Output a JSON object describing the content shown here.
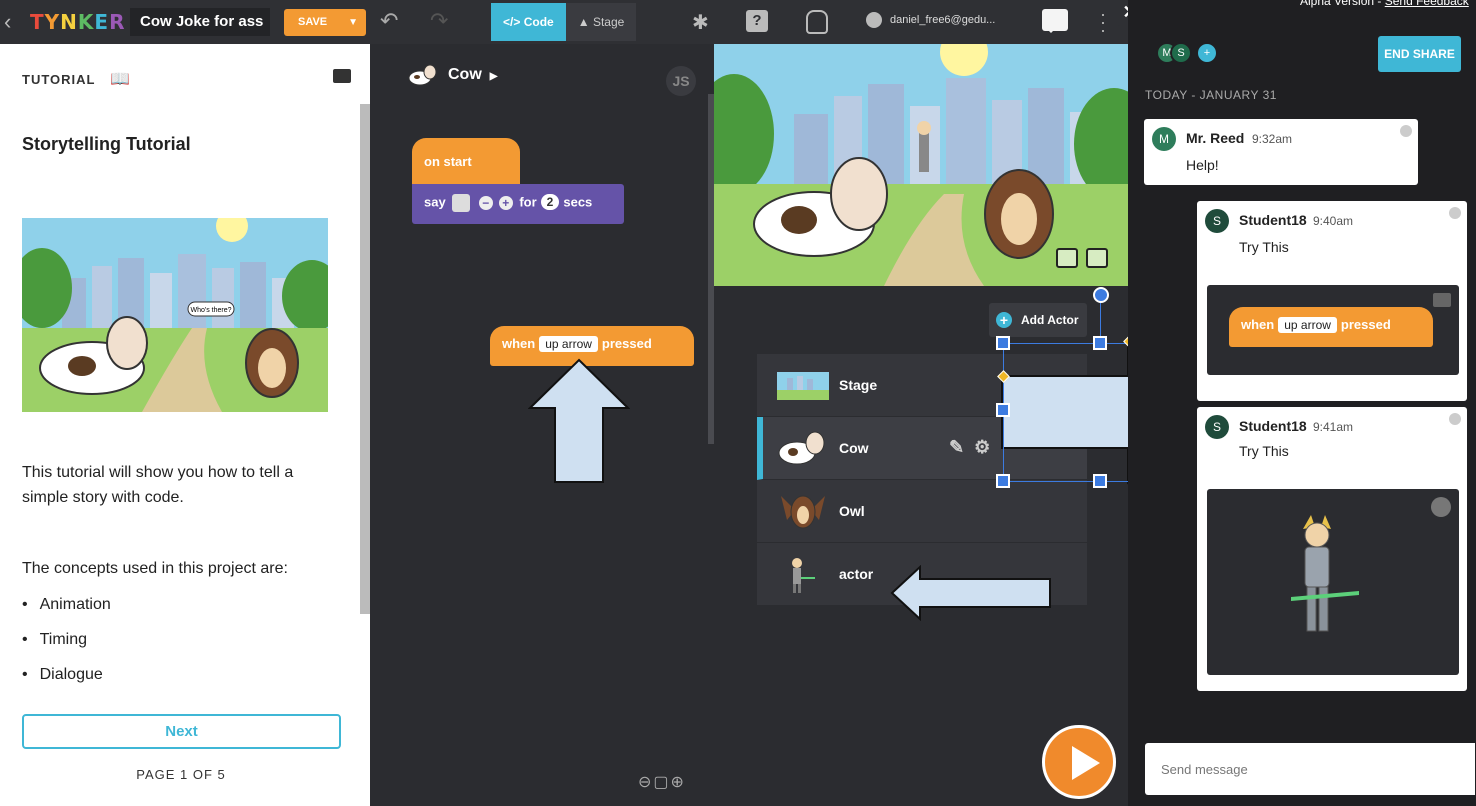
{
  "topbar": {
    "logo": "TYNKER",
    "project_name": "Cow Joke for ass",
    "save_label": "SAVE",
    "tabs": [
      {
        "label": "Code",
        "active": true
      },
      {
        "label": "Stage",
        "active": false
      }
    ],
    "user_email": "daniel_free6@gedu..."
  },
  "tutorial": {
    "header": "TUTORIAL",
    "title": "Storytelling Tutorial",
    "image_speech": "Who's there?",
    "intro": "This tutorial will show you how to tell a simple story with code.",
    "concepts_label": "The concepts used in this project are:",
    "concepts": [
      "Animation",
      "Timing",
      "Dialogue"
    ],
    "next_label": "Next",
    "page_indicator": "PAGE 1 OF 5"
  },
  "workspace": {
    "actor_name": "Cow",
    "js_badge": "JS",
    "block1": {
      "hat": "on start",
      "say": "say",
      "for": "for",
      "secs_value": "2",
      "secs": "secs"
    },
    "block2": {
      "when": "when",
      "key": "up arrow",
      "pressed": "pressed"
    }
  },
  "actors": {
    "add_label": "Add Actor",
    "items": [
      {
        "name": "Stage",
        "selected": false
      },
      {
        "name": "Cow",
        "selected": true
      },
      {
        "name": "Owl",
        "selected": false
      },
      {
        "name": "actor",
        "selected": false
      }
    ]
  },
  "chat": {
    "alpha_text": "Alpha Version - ",
    "feedback_link": "Send Feedback",
    "avatars": [
      "M",
      "S",
      "+"
    ],
    "end_share_label": "END SHARE",
    "date_label": "TODAY - JANUARY 31",
    "messages": [
      {
        "avatar": "M",
        "author": "Mr. Reed",
        "time": "9:32am",
        "text": "Help!"
      },
      {
        "avatar": "S",
        "author": "Student18",
        "time": "9:40am",
        "text": "Try This",
        "card": {
          "when": "when",
          "key": "up arrow",
          "pressed": "pressed"
        }
      },
      {
        "avatar": "S",
        "author": "Student18",
        "time": "9:41am",
        "text": "Try This"
      }
    ],
    "input_placeholder": "Send message"
  },
  "colors": {
    "accent": "#3fb7d6",
    "orange": "#f39a33",
    "purple": "#6553a8",
    "dark_bg": "#2b2c30",
    "selection": "#3c7be0"
  }
}
